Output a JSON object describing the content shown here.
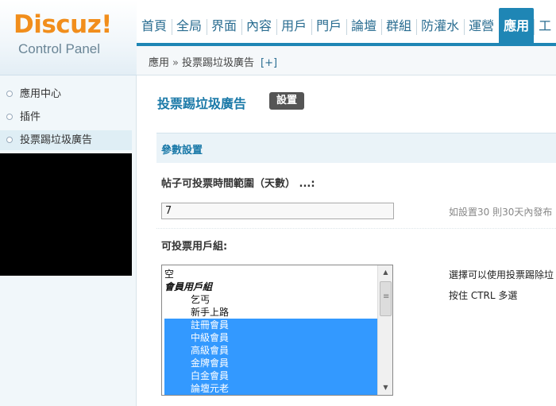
{
  "logo": {
    "main": "Discuz!",
    "sub": "Control Panel"
  },
  "nav": {
    "items": [
      "首頁",
      "全局",
      "界面",
      "內容",
      "用戶",
      "門戶",
      "論壇",
      "群組",
      "防灌水",
      "運營",
      "應用",
      "工"
    ],
    "active_index": 10
  },
  "breadcrumb": {
    "root": "應用",
    "separator": "»",
    "current": "投票踢垃圾廣告",
    "add": "[+]"
  },
  "sidebar": {
    "items": [
      {
        "label": "應用中心"
      },
      {
        "label": "插件"
      },
      {
        "label": "投票踢垃圾廣告"
      }
    ],
    "active_index": 2
  },
  "main": {
    "title": "投票踢垃圾廣告",
    "settings_button": "設置",
    "section_title": "參數設置",
    "field1": {
      "label": "帖子可投票時間範圍（天數） ...:",
      "value": "7",
      "hint": "如設置30 則30天內發布"
    },
    "field2": {
      "label": "可投票用戶組:",
      "hint1": "選擇可以使用投票踢除垃",
      "hint2": "按住 CTRL 多選",
      "options": [
        {
          "label": "空",
          "type": "plain",
          "selected": false
        },
        {
          "label": "會員用戶組",
          "type": "group",
          "selected": false
        },
        {
          "label": "乞丐",
          "type": "indent",
          "selected": false
        },
        {
          "label": "新手上路",
          "type": "indent",
          "selected": false
        },
        {
          "label": "註冊會員",
          "type": "indent",
          "selected": true
        },
        {
          "label": "中級會員",
          "type": "indent",
          "selected": true
        },
        {
          "label": "高級會員",
          "type": "indent",
          "selected": true
        },
        {
          "label": "金牌會員",
          "type": "indent",
          "selected": true
        },
        {
          "label": "白金會員",
          "type": "indent",
          "selected": true
        },
        {
          "label": "論壇元老",
          "type": "indent",
          "selected": true
        }
      ]
    }
  },
  "colors": {
    "accent": "#1f86b5",
    "logo_orange": "#f18e1c",
    "selection": "#3399ff"
  }
}
